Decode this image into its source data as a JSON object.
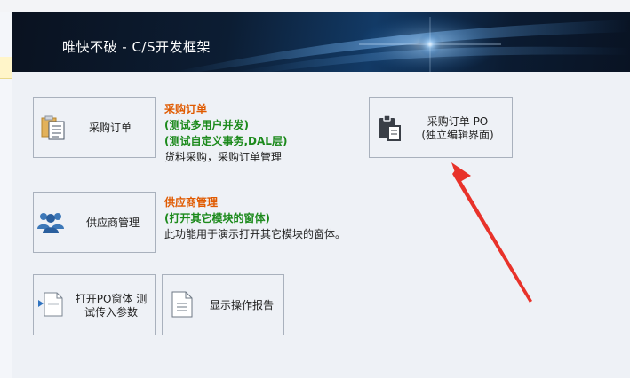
{
  "banner": {
    "title": "唯快不破 - C/S开发框架"
  },
  "tiles": {
    "purchase_order": {
      "label": "采购订单"
    },
    "purchase_order_po": {
      "label_line1": "采购订单 PO",
      "label_line2": "(独立编辑界面)"
    },
    "supplier": {
      "label": "供应商管理"
    },
    "open_po": {
      "label_line1": "打开PO窗体 测",
      "label_line2": "试传入参数"
    },
    "report": {
      "label": "显示操作报告"
    }
  },
  "descriptions": {
    "purchase": {
      "title": "采购订单",
      "line1": "(测试多用户并发)",
      "line2": "(测试自定义事务,DAL层)",
      "line3": "货料采购，采购订单管理"
    },
    "supplier": {
      "title": "供应商管理",
      "line1": "(打开其它模块的窗体)",
      "line2": "此功能用于演示打开其它模块的窗体。"
    }
  },
  "colors": {
    "accent_orange": "#e05a00",
    "accent_green": "#1c8a1c",
    "arrow_red": "#e8322a"
  }
}
